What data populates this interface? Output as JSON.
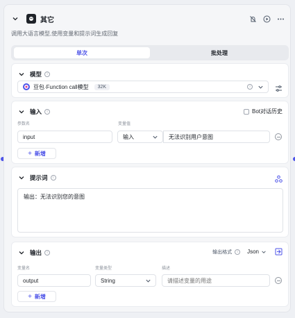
{
  "node": {
    "title": "其它",
    "description": "调用大语言模型,使用变量和提示词生成回复"
  },
  "tabs": [
    {
      "label": "单次"
    },
    {
      "label": "批处理"
    }
  ],
  "model_section": {
    "title": "模型",
    "model_name": "豆包·Function call模型",
    "badge": "32K"
  },
  "input_section": {
    "title": "输入",
    "bot_history_label": "Bot对话历史",
    "col_param": "参数名",
    "col_value": "变量值",
    "row": {
      "name": "input",
      "type": "输入",
      "value": "无法识别用户意图"
    },
    "add_label": "新增"
  },
  "prompt_section": {
    "title": "提示词",
    "text": "输出：无法识别您的意图"
  },
  "output_section": {
    "title": "输出",
    "format_label": "输出格式",
    "format_value": "Json",
    "col_name": "变量名",
    "col_type": "变量类型",
    "col_desc": "描述",
    "row": {
      "name": "output",
      "type": "String",
      "desc_placeholder": "请描述变量的用途"
    },
    "add_label": "新增"
  },
  "colors": {
    "accent": "#4d53e8",
    "text": "#1f2329",
    "muted": "#8f959e"
  }
}
